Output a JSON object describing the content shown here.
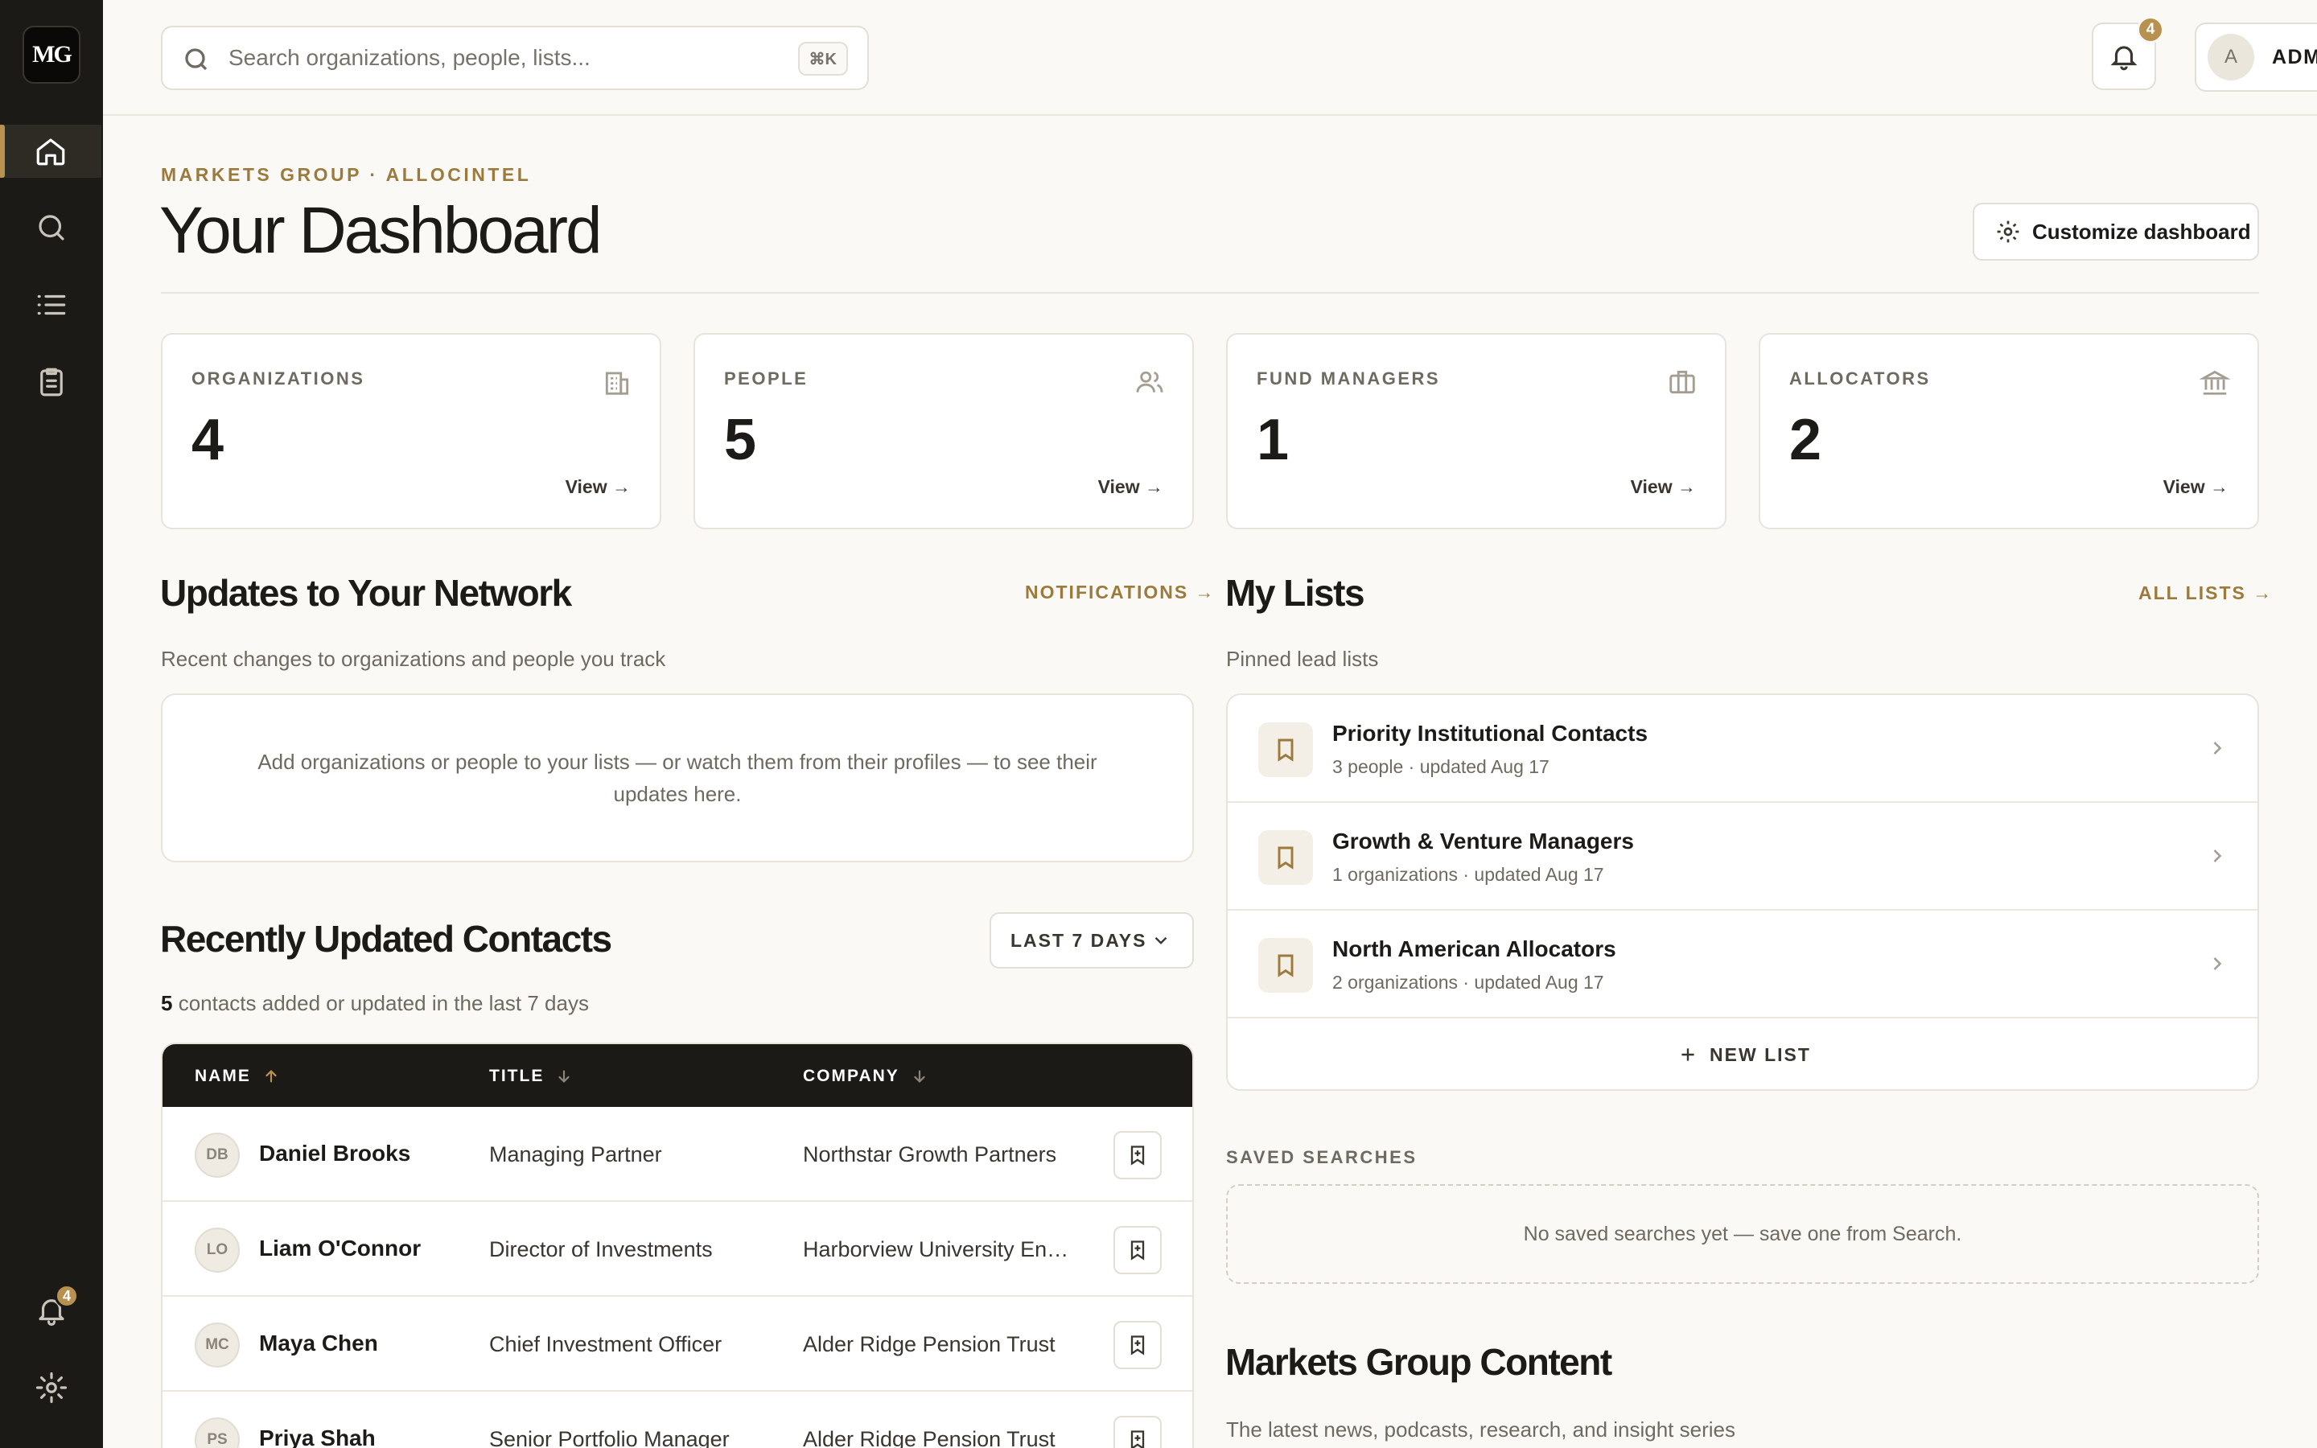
{
  "sidebar": {
    "logo_text": "MG",
    "items": [
      {
        "name": "home",
        "active": true
      },
      {
        "name": "search",
        "active": false
      },
      {
        "name": "lists",
        "active": false
      },
      {
        "name": "reports",
        "active": false
      }
    ],
    "notification_count": "4"
  },
  "topbar": {
    "search_placeholder": "Search organizations, people, lists...",
    "shortcut": "⌘K",
    "notification_count": "4",
    "user_initial": "A",
    "user_name": "ADMIN"
  },
  "header": {
    "eyebrow": "MARKETS GROUP · ALLOCINTEL",
    "title": "Your Dashboard",
    "customize_label": "Customize dashboard"
  },
  "stats": [
    {
      "label": "ORGANIZATIONS",
      "value": "4",
      "link": "View →",
      "icon": "building-icon"
    },
    {
      "label": "PEOPLE",
      "value": "5",
      "link": "View →",
      "icon": "people-icon"
    },
    {
      "label": "FUND MANAGERS",
      "value": "1",
      "link": "View →",
      "icon": "briefcase-icon"
    },
    {
      "label": "ALLOCATORS",
      "value": "2",
      "link": "View →",
      "icon": "bank-icon"
    }
  ],
  "updates": {
    "title": "Updates to Your Network",
    "link": "NOTIFICATIONS →",
    "subtitle": "Recent changes to organizations and people you track",
    "empty_text": "Add organizations or people to your lists — or watch them from their profiles — to see their updates here."
  },
  "contacts": {
    "title": "Recently Updated Contacts",
    "range_label": "LAST 7 DAYS",
    "count": "5",
    "count_text": "contacts added or updated in the last 7 days",
    "columns": {
      "name": "NAME",
      "title": "TITLE",
      "company": "COMPANY"
    },
    "rows": [
      {
        "initials": "DB",
        "name": "Daniel Brooks",
        "title": "Managing Partner",
        "company": "Northstar Growth Partners"
      },
      {
        "initials": "LO",
        "name": "Liam O'Connor",
        "title": "Director of Investments",
        "company": "Harborview University Endowment"
      },
      {
        "initials": "MC",
        "name": "Maya Chen",
        "title": "Chief Investment Officer",
        "company": "Alder Ridge Pension Trust"
      },
      {
        "initials": "PS",
        "name": "Priya Shah",
        "title": "Senior Portfolio Manager",
        "company": "Alder Ridge Pension Trust"
      }
    ]
  },
  "lists": {
    "title": "My Lists",
    "link": "ALL LISTS →",
    "subtitle": "Pinned lead lists",
    "items": [
      {
        "name": "Priority Institutional Contacts",
        "meta": "3 people · updated Aug 17"
      },
      {
        "name": "Growth & Venture Managers",
        "meta": "1 organizations · updated Aug 17"
      },
      {
        "name": "North American Allocators",
        "meta": "2 organizations · updated Aug 17"
      }
    ],
    "new_label": "NEW LIST"
  },
  "saved_searches": {
    "label": "SAVED SEARCHES",
    "empty_text": "No saved searches yet — save one from Search."
  },
  "content": {
    "title": "Markets Group Content",
    "subtitle": "The latest news, podcasts, research, and insight series"
  },
  "colors": {
    "accent": "#b8914f",
    "sidebar": "#1c1a17",
    "background": "#faf9f6"
  }
}
